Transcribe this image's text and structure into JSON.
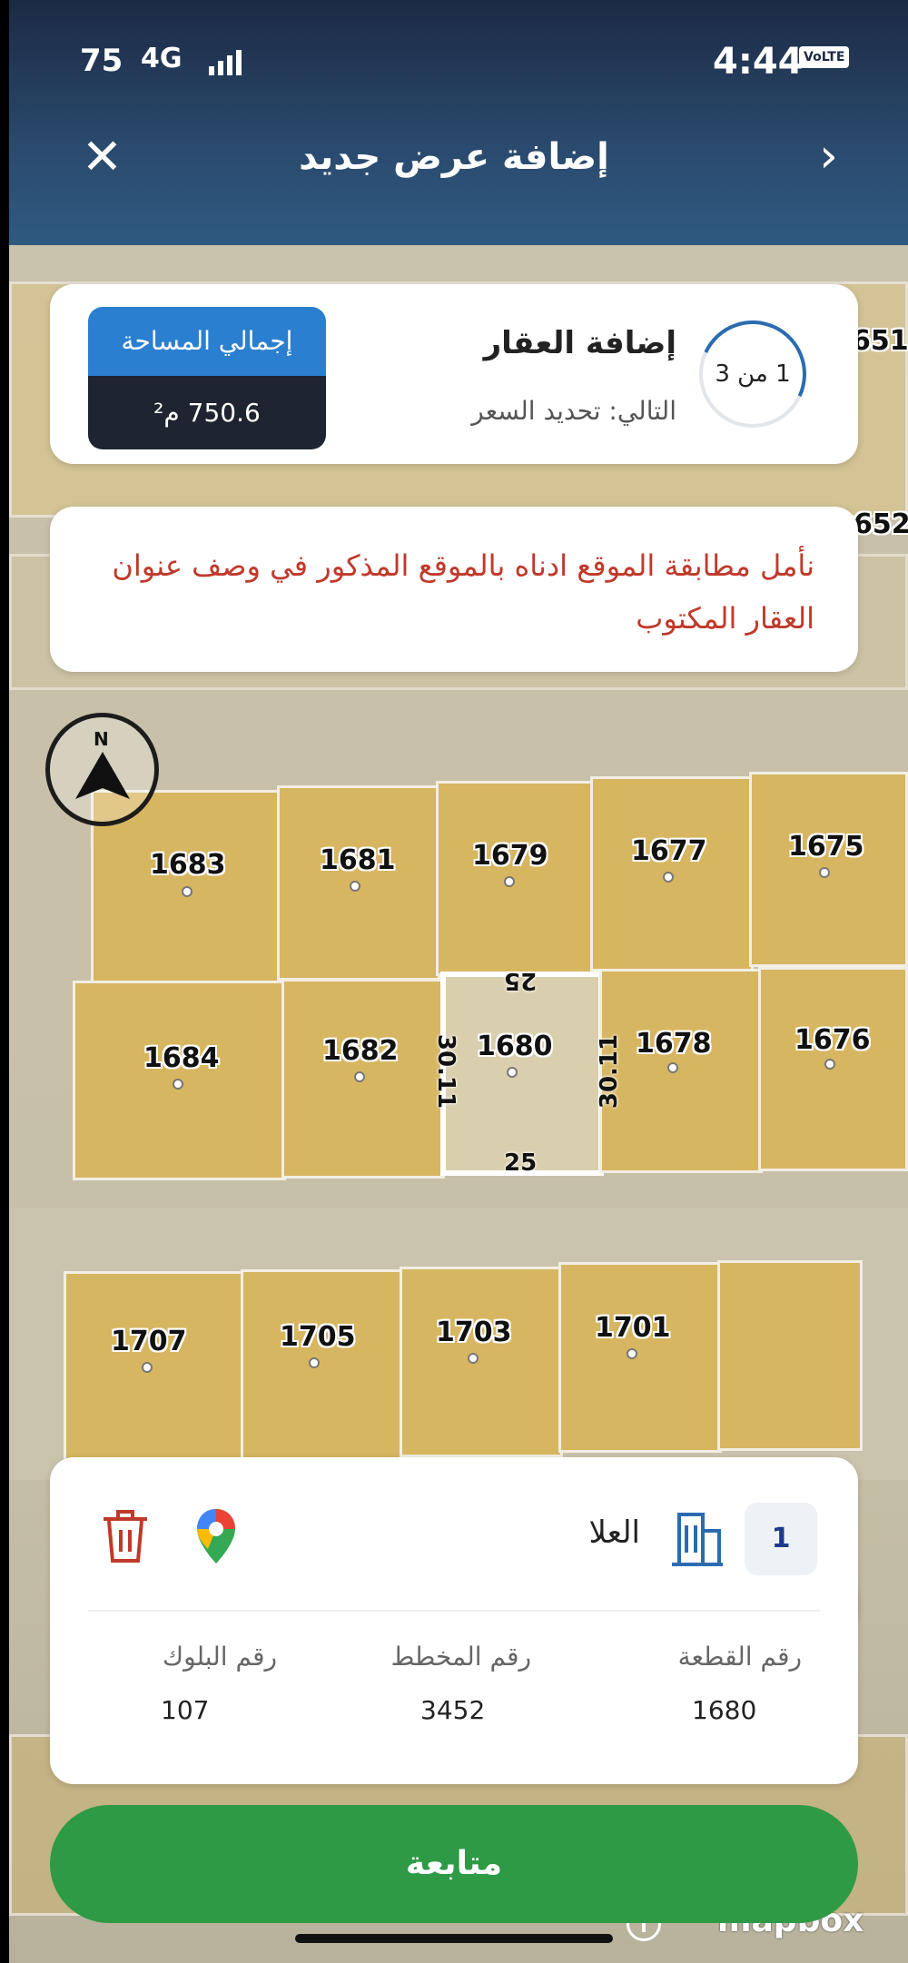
{
  "status": {
    "battery": "75",
    "network": "4G",
    "volte": "VoLTE",
    "time": "4:44"
  },
  "header": {
    "title": "إضافة عرض جديد",
    "close_icon": "close-icon",
    "next_icon": "chevron-right-icon"
  },
  "step_card": {
    "step": "1 من 3",
    "title": "إضافة العقار",
    "next_label": "التالي: تحديد السعر",
    "area_label": "إجمالي المساحة",
    "area_value": "750.6 م²"
  },
  "notice": {
    "text": "نأمل مطابقة الموقع ادناه بالموقع المذكور في وصف عنوان العقار المكتوب",
    "color": "#c0392b"
  },
  "map": {
    "compass_letter": "N",
    "edge_labels": {
      "top_right": "651",
      "mid_right": "652"
    },
    "plots": {
      "p1683": "1683",
      "p1681": "1681",
      "p1679": "1679",
      "p1677": "1677",
      "p1675": "1675",
      "p1684": "1684",
      "p1682": "1682",
      "p1680": "1680",
      "p1678": "1678",
      "p1676": "1676",
      "p1707": "1707",
      "p1705": "1705",
      "p1703": "1703",
      "p1701": "1701"
    },
    "dims": {
      "top": "25",
      "bottom": "25",
      "left": "30.11",
      "right": "30.11"
    },
    "attribution": "mapbox"
  },
  "property_card": {
    "index": "1",
    "city": "العلا",
    "col1_label": "رقم القطعة",
    "col1_value": "1680",
    "col2_label": "رقم المخطط",
    "col2_value": "3452",
    "col3_label": "رقم البلوك",
    "col3_value": "107",
    "delete_color": "#c0392b",
    "accent": "#2b6cb0"
  },
  "continue_label": "متابعة"
}
